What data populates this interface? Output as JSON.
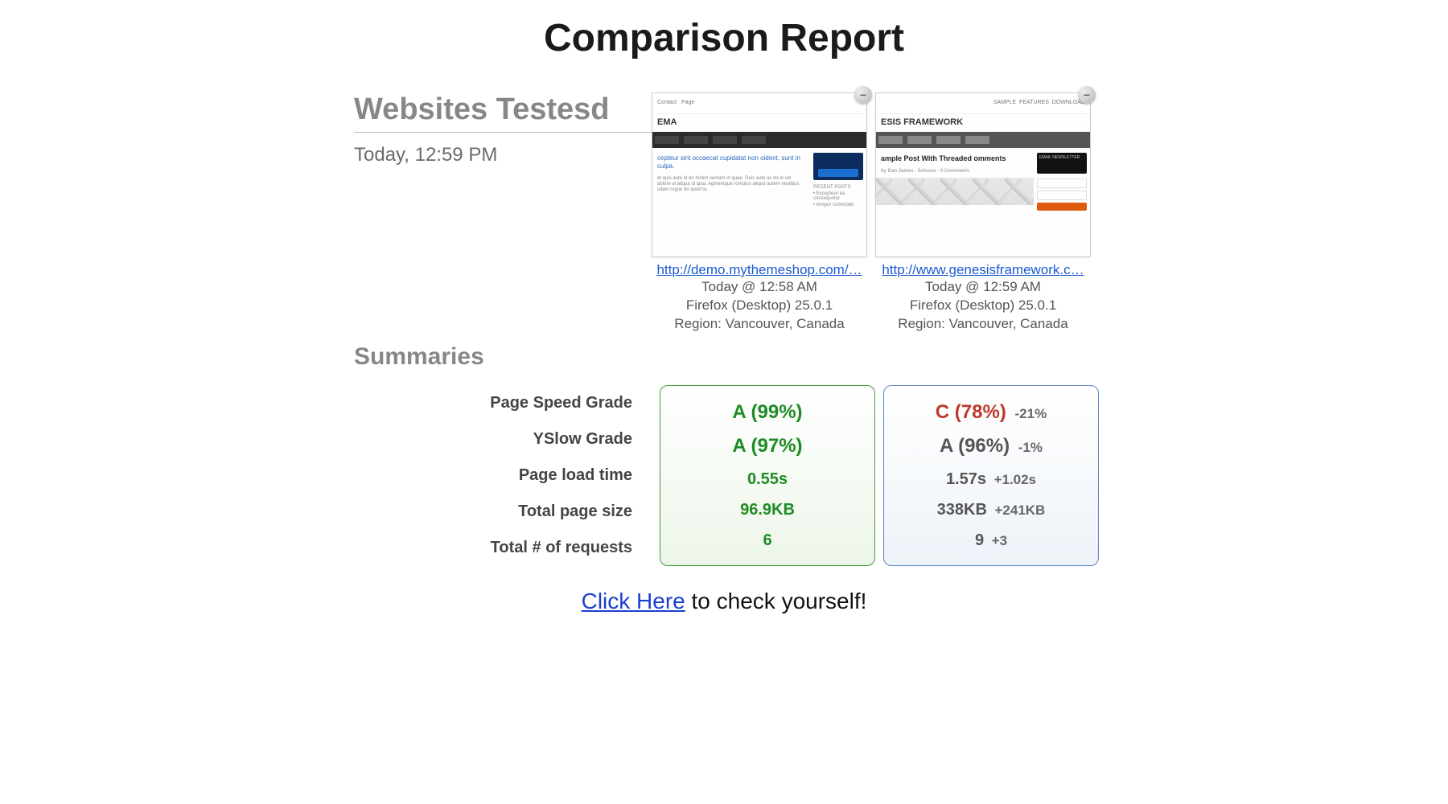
{
  "title": "Comparison Report",
  "tested": {
    "heading": "Websites Testesd",
    "when": "Today, 12:59 PM"
  },
  "sites": [
    {
      "thumb_brand": "EMA",
      "headline": "cepteur sint occaecat cupidatat non oident, sunt in culpa.",
      "side_heading": "RECENT POSTS",
      "url": "http://demo.mythemeshop.com/…",
      "when": "Today @ 12:58 AM",
      "browser": "Firefox (Desktop) 25.0.1",
      "region": "Region: Vancouver, Canada",
      "remove": "−"
    },
    {
      "thumb_brand": "ESIS FRAMEWORK",
      "headline": "ample Post With Threaded omments",
      "side_heading": "EMAIL NEWSLETTER",
      "url": "http://www.genesisframework.c…",
      "when": "Today @ 12:59 AM",
      "browser": "Firefox (Desktop) 25.0.1",
      "region": "Region: Vancouver, Canada",
      "remove": "−"
    }
  ],
  "summaries": {
    "heading": "Summaries",
    "labels": {
      "pagespeed": "Page Speed Grade",
      "yslow": "YSlow Grade",
      "loadtime": "Page load time",
      "pagesize": "Total page size",
      "requests": "Total # of requests"
    },
    "a": {
      "pagespeed": "A (99%)",
      "yslow": "A (97%)",
      "loadtime": "0.55s",
      "pagesize": "96.9KB",
      "requests": "6"
    },
    "b": {
      "pagespeed": "C (78%)",
      "pagespeed_delta": "-21%",
      "yslow": "A (96%)",
      "yslow_delta": "-1%",
      "loadtime": "1.57s",
      "loadtime_delta": "+1.02s",
      "pagesize": "338KB",
      "pagesize_delta": "+241KB",
      "requests": "9",
      "requests_delta": "+3"
    }
  },
  "cta": {
    "link": "Click Here",
    "rest": " to check yourself!"
  }
}
